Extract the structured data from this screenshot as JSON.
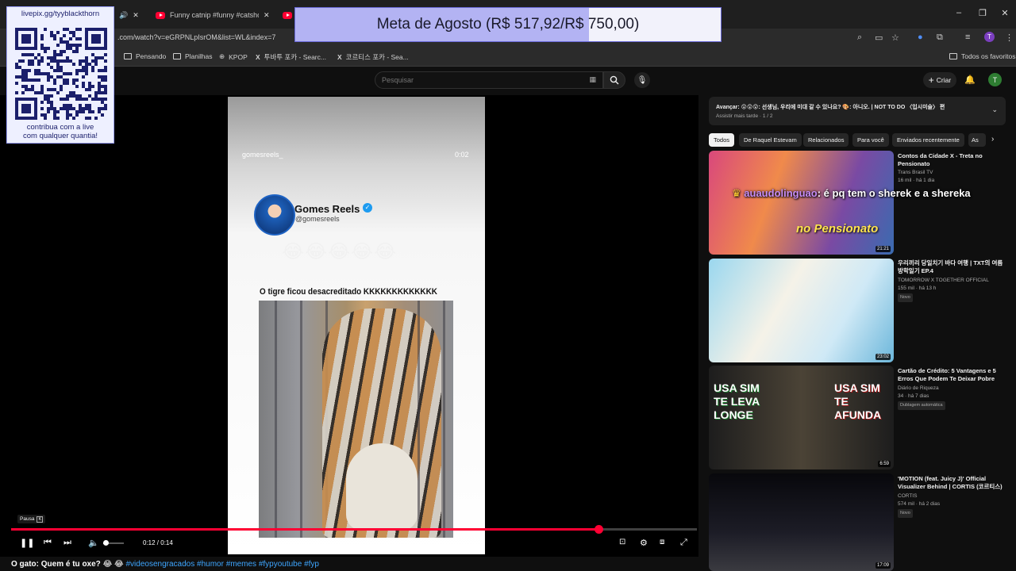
{
  "browser": {
    "tabs": [
      {
        "label": "Funny catnip #funny #catshorts"
      }
    ],
    "url": ".com/watch?v=eGRPNLpIsrOM&list=WL&index=7",
    "bookmarks": [
      "Pensando",
      "Planilhas",
      "KPOP",
      "투바투 포카 - Searc...",
      "코르티스 포카 - Sea..."
    ],
    "all_favorites": "Todos os favoritos"
  },
  "stream_overlay": {
    "goal_text": "Meta de Agosto (R$ 517,92/R$ 750,00)",
    "goal_progress": 0.69,
    "qr_title": "livepix.gg/tyyblackthorn",
    "qr_caption_line1": "contribua com a live",
    "qr_caption_line2": "com qualquer quantia!",
    "chat_user": "auaudolinguao",
    "chat_message": ": é pq tem o sherek e a shereka"
  },
  "youtube": {
    "search_placeholder": "Pesquisar",
    "create_label": "Criar",
    "avatar_letter": "T"
  },
  "player": {
    "reel_handle": "gomesreels_",
    "reel_time": "0:02",
    "reel_name": "Gomes Reels",
    "reel_username": "@gomesreels",
    "emoji_row": "😂😂😂😂😂",
    "reel_caption": "O tigre ficou desacreditado KKKKKKKKKKKKK",
    "tooltip_label": "Pausa",
    "tooltip_key": "K",
    "time": "0:12 / 0:14",
    "progress": 0.857,
    "volume": 0.1,
    "title_text": "O gato: Quem é tu oxe? 😂 😂 ",
    "title_tags": "#videosengracados #humor #memes #fypyoutube #fyp"
  },
  "sidebar": {
    "playlist_title": "Avançar: 😲😲😲: 선생님, 우리에 미대 갈 수 있나요? 🎨: 아니오. | NOT TO DO 〈입시미술〉 편",
    "playlist_sub": "Assistir mais tarde · 1 / 2",
    "chips": [
      "Todos",
      "De Raquel Estevam",
      "Relacionados",
      "Para você",
      "Enviados recentemente",
      "As"
    ],
    "videos": [
      {
        "title": "Contos da Cidade X - Treta no Pensionato",
        "channel": "Trans Brasil TV",
        "stats": "16 mil · há 1 dia",
        "duration": "21:21",
        "badge": "",
        "colors": [
          "#d9487c",
          "#7a4aa3"
        ]
      },
      {
        "title": "우리끼리 당일치기 바다 여행 | TXT의 여름방학일기 EP.4",
        "channel": "TOMORROW X TOGETHER OFFICIAL",
        "stats": "155 mil · há 13 h",
        "duration": "23:02",
        "badge": "Novo",
        "colors": [
          "#7fc5e6",
          "#f5f2e8"
        ]
      },
      {
        "title": "Cartão de Crédito: 5 Vantagens e 5 Erros Que Podem Te Deixar Pobre",
        "channel": "Diário de Riqueza",
        "stats": "34 · há 7 dias",
        "duration": "6:59",
        "badge": "Dublagem automática",
        "colors": [
          "#2a2a2a",
          "#7a6a55"
        ]
      },
      {
        "title": "'MOTION (feat. Juicy J)' Official Visualizer Behind | CORTIS (코르티스)",
        "channel": "CORTIS",
        "stats": "574 mil · há 2 dias",
        "duration": "17:09",
        "badge": "Novo",
        "colors": [
          "#0b0b10",
          "#2a2a35"
        ]
      }
    ],
    "thumb_texts": {
      "left": "USA SIM TE LEVA LONGE",
      "right": "USA SIM TE AFUNDA",
      "pension": "no Pensionato"
    }
  }
}
